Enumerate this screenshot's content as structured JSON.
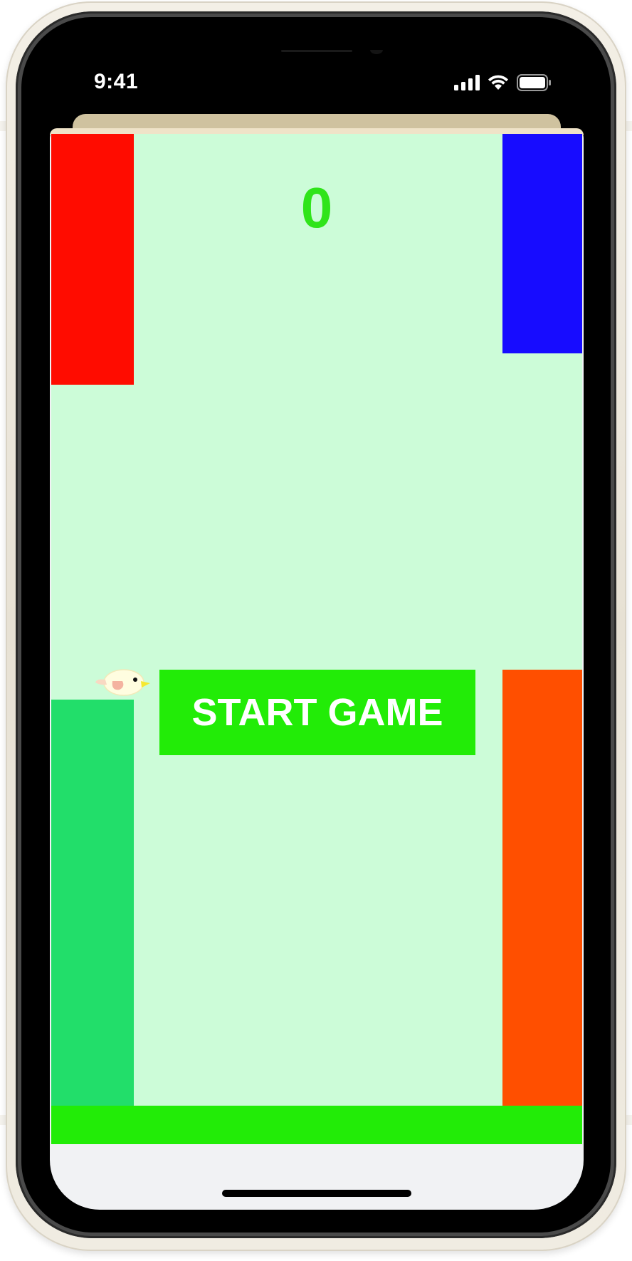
{
  "status_bar": {
    "time": "9:41",
    "icons": [
      "signal-icon",
      "wifi-icon",
      "battery-icon"
    ]
  },
  "game": {
    "score": "0",
    "start_button_label": "START GAME",
    "colors": {
      "background": "#ccfcd8",
      "score": "#2fe41a",
      "button": "#22ec07",
      "ground": "#22ec07",
      "pipe_top_left": "#ff0c00",
      "pipe_top_right": "#170cff",
      "pipe_bottom_left": "#22de6a",
      "pipe_bottom_right": "#ff4f00"
    }
  }
}
